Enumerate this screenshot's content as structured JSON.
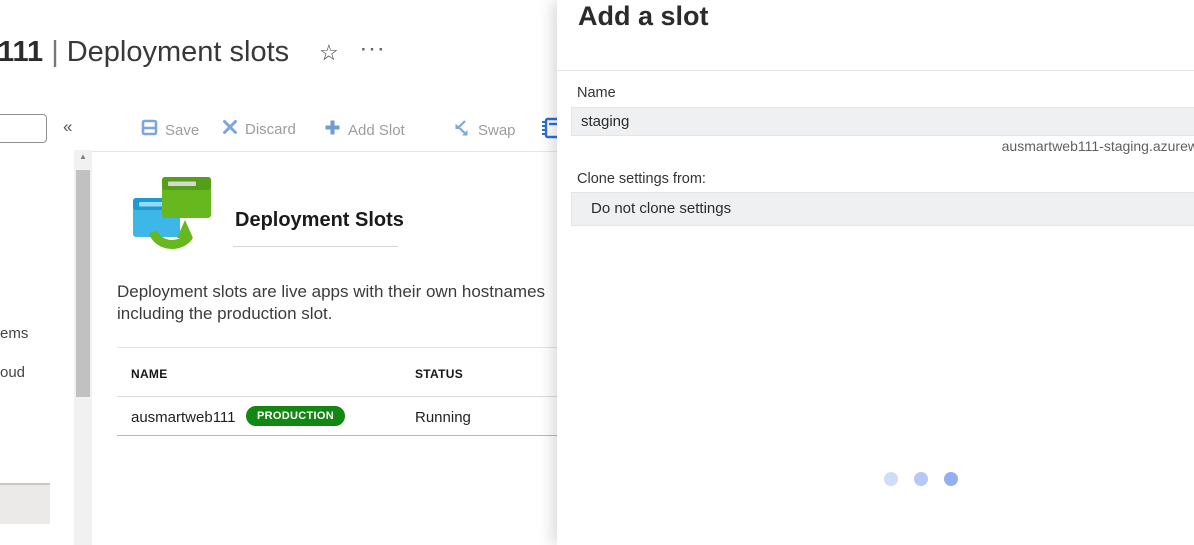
{
  "page": {
    "title_name": "111",
    "title_sep": "|",
    "title_rest": "Deployment slots",
    "favorite_icon": "☆",
    "more_icon": "···"
  },
  "command_bar": {
    "collapse_icon": "«",
    "buttons": [
      {
        "label": "Save",
        "icon": "save-icon"
      },
      {
        "label": "Discard",
        "icon": "discard-icon"
      },
      {
        "label": "Add Slot",
        "icon": "add-icon"
      },
      {
        "label": "Swap",
        "icon": "swap-icon"
      }
    ]
  },
  "sidebar": {
    "items": [
      {
        "label": "ems"
      },
      {
        "label": "oud"
      }
    ]
  },
  "scrollbar": {
    "up_arrow": "▲"
  },
  "content": {
    "heading": "Deployment Slots",
    "description_line1": "Deployment slots are live apps with their own hostnames",
    "description_line2": "including the production slot.",
    "table": {
      "columns": [
        "NAME",
        "STATUS"
      ],
      "rows": [
        {
          "name": "ausmartweb111",
          "badge": "PRODUCTION",
          "status": "Running"
        }
      ]
    }
  },
  "panel": {
    "title": "Add a slot",
    "name_field": {
      "label": "Name",
      "value": "staging"
    },
    "hostname_preview": "ausmartweb111-staging.azurew",
    "clone_field": {
      "label": "Clone settings from:",
      "value": "Do not clone settings"
    }
  },
  "colors": {
    "toolbar_icon_blue": "#7da7dc",
    "toolbar_label_grey": "#9d9d9d",
    "production_badge_green": "#128712",
    "slot_icon_blue": "#3db6e8",
    "slot_icon_green": "#67b71f",
    "loading_dot_1": "#cfdcf9",
    "loading_dot_2": "#b6c9f6",
    "loading_dot_3": "#94aff1"
  }
}
